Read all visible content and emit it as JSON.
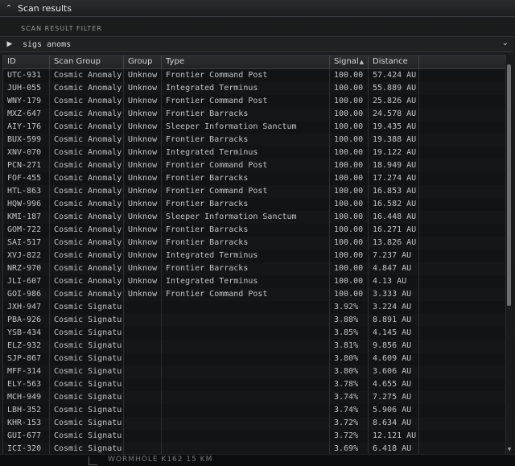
{
  "window": {
    "title": "Scan results",
    "collapse_icon": "chevron-up-double-icon"
  },
  "filter": {
    "label": "SCAN RESULT FILTER",
    "value": "sigs anoms",
    "expand_icon": "chevron-down-double-icon"
  },
  "table": {
    "columns": [
      "ID",
      "Scan Group",
      "Group",
      "Type",
      "Signal",
      "Distance"
    ],
    "sorted_column": "Signal",
    "rows": [
      {
        "id": "UTC-931",
        "scan_group": "Cosmic Anomaly",
        "group": "Unknow",
        "type": "Frontier Command Post",
        "signal": "100.00",
        "distance": "57.424 AU"
      },
      {
        "id": "JUH-055",
        "scan_group": "Cosmic Anomaly",
        "group": "Unknow",
        "type": "Integrated Terminus",
        "signal": "100.00",
        "distance": "55.889 AU"
      },
      {
        "id": "WNY-179",
        "scan_group": "Cosmic Anomaly",
        "group": "Unknow",
        "type": "Frontier Command Post",
        "signal": "100.00",
        "distance": "25.826 AU"
      },
      {
        "id": "MXZ-647",
        "scan_group": "Cosmic Anomaly",
        "group": "Unknow",
        "type": "Frontier Barracks",
        "signal": "100.00",
        "distance": "24.578 AU"
      },
      {
        "id": "AIY-176",
        "scan_group": "Cosmic Anomaly",
        "group": "Unknow",
        "type": "Sleeper Information Sanctum",
        "signal": "100.00",
        "distance": "19.435 AU"
      },
      {
        "id": "BUX-599",
        "scan_group": "Cosmic Anomaly",
        "group": "Unknow",
        "type": "Frontier Barracks",
        "signal": "100.00",
        "distance": "19.388 AU"
      },
      {
        "id": "XNV-070",
        "scan_group": "Cosmic Anomaly",
        "group": "Unknow",
        "type": "Integrated Terminus",
        "signal": "100.00",
        "distance": "19.122 AU"
      },
      {
        "id": "PCN-271",
        "scan_group": "Cosmic Anomaly",
        "group": "Unknow",
        "type": "Frontier Command Post",
        "signal": "100.00",
        "distance": "18.949 AU"
      },
      {
        "id": "FOF-455",
        "scan_group": "Cosmic Anomaly",
        "group": "Unknow",
        "type": "Frontier Barracks",
        "signal": "100.00",
        "distance": "17.274 AU"
      },
      {
        "id": "HTL-863",
        "scan_group": "Cosmic Anomaly",
        "group": "Unknow",
        "type": "Frontier Command Post",
        "signal": "100.00",
        "distance": "16.853 AU"
      },
      {
        "id": "HQW-996",
        "scan_group": "Cosmic Anomaly",
        "group": "Unknow",
        "type": "Frontier Barracks",
        "signal": "100.00",
        "distance": "16.582 AU"
      },
      {
        "id": "KMI-187",
        "scan_group": "Cosmic Anomaly",
        "group": "Unknow",
        "type": "Sleeper Information Sanctum",
        "signal": "100.00",
        "distance": "16.448 AU"
      },
      {
        "id": "GOM-722",
        "scan_group": "Cosmic Anomaly",
        "group": "Unknow",
        "type": "Frontier Barracks",
        "signal": "100.00",
        "distance": "16.271 AU"
      },
      {
        "id": "SAI-517",
        "scan_group": "Cosmic Anomaly",
        "group": "Unknow",
        "type": "Frontier Barracks",
        "signal": "100.00",
        "distance": "13.826 AU"
      },
      {
        "id": "XVJ-822",
        "scan_group": "Cosmic Anomaly",
        "group": "Unknow",
        "type": "Integrated Terminus",
        "signal": "100.00",
        "distance": "7.237 AU"
      },
      {
        "id": "NRZ-970",
        "scan_group": "Cosmic Anomaly",
        "group": "Unknow",
        "type": "Frontier Barracks",
        "signal": "100.00",
        "distance": "4.847 AU"
      },
      {
        "id": "JLI-607",
        "scan_group": "Cosmic Anomaly",
        "group": "Unknow",
        "type": "Integrated Terminus",
        "signal": "100.00",
        "distance": "4.13 AU"
      },
      {
        "id": "GOI-986",
        "scan_group": "Cosmic Anomaly",
        "group": "Unknow",
        "type": "Frontier Command Post",
        "signal": "100.00",
        "distance": "3.333 AU"
      },
      {
        "id": "JXH-947",
        "scan_group": "Cosmic Signatur",
        "group": "",
        "type": "",
        "signal": "3.92%",
        "distance": "3.224 AU"
      },
      {
        "id": "PBA-926",
        "scan_group": "Cosmic Signatur",
        "group": "",
        "type": "",
        "signal": "3.88%",
        "distance": "8.891 AU"
      },
      {
        "id": "YSB-434",
        "scan_group": "Cosmic Signatur",
        "group": "",
        "type": "",
        "signal": "3.85%",
        "distance": "4.145 AU"
      },
      {
        "id": "ELZ-932",
        "scan_group": "Cosmic Signatur",
        "group": "",
        "type": "",
        "signal": "3.81%",
        "distance": "9.856 AU"
      },
      {
        "id": "SJP-867",
        "scan_group": "Cosmic Signatur",
        "group": "",
        "type": "",
        "signal": "3.80%",
        "distance": "4.609 AU"
      },
      {
        "id": "MFF-314",
        "scan_group": "Cosmic Signatur",
        "group": "",
        "type": "",
        "signal": "3.80%",
        "distance": "3.606 AU"
      },
      {
        "id": "ELY-563",
        "scan_group": "Cosmic Signatur",
        "group": "",
        "type": "",
        "signal": "3.78%",
        "distance": "4.655 AU"
      },
      {
        "id": "MCH-949",
        "scan_group": "Cosmic Signatur",
        "group": "",
        "type": "",
        "signal": "3.74%",
        "distance": "7.275 AU"
      },
      {
        "id": "LBH-352",
        "scan_group": "Cosmic Signatur",
        "group": "",
        "type": "",
        "signal": "3.74%",
        "distance": "5.906 AU"
      },
      {
        "id": "KHR-153",
        "scan_group": "Cosmic Signatur",
        "group": "",
        "type": "",
        "signal": "3.72%",
        "distance": "8.634 AU"
      },
      {
        "id": "GUI-677",
        "scan_group": "Cosmic Signatur",
        "group": "",
        "type": "",
        "signal": "3.72%",
        "distance": "12.121 AU"
      },
      {
        "id": "ICI-320",
        "scan_group": "Cosmic Signatur",
        "group": "",
        "type": "",
        "signal": "3.69%",
        "distance": "6.418 AU"
      }
    ]
  },
  "bottom": {
    "text": "WORMHOLE K162 15 KM"
  },
  "colors": {
    "background": "#141617",
    "text": "#c4c7c4",
    "header": "#2b2e30"
  }
}
